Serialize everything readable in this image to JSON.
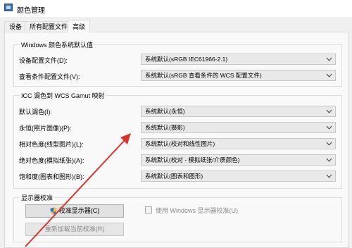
{
  "window": {
    "title": "颜色管理"
  },
  "tabs": [
    {
      "label": "设备"
    },
    {
      "label": "所有配置文件"
    },
    {
      "label": "高级"
    }
  ],
  "windows_defaults": {
    "title": "Windows 颜色系统默认值",
    "rows": [
      {
        "label": "设备配置文件(D):",
        "value": "系统默认(sRGB IEC61966-2.1)"
      },
      {
        "label": "查看条件配置文件(V):",
        "value": "系统默认(sRGB 查看条件的 WCS 配置文件)"
      }
    ]
  },
  "gamut_mapping": {
    "title": "ICC 调色到 WCS Gamut 映射",
    "rows": [
      {
        "label": "默认调色(I):",
        "value": "系统默认(永恒)"
      },
      {
        "label": "永恒(照片图像)(P):",
        "value": "系统默认(摄影)"
      },
      {
        "label": "相对色度(线型图片)(L):",
        "value": "系统默认(校对和线性图片)"
      },
      {
        "label": "绝对色度(模拟纸张)(A):",
        "value": "系统默认(校对 - 模拟纸张/介质颜色)"
      },
      {
        "label": "饱和度(图表和图形)(B):",
        "value": "系统默认(图表和图形)"
      }
    ]
  },
  "display_calibration": {
    "title": "显示器校准",
    "calibrate_button": "校准显示器(C)",
    "reload_button": "重新加载当前校准(R)",
    "use_windows_calibration": "使用 Windows 显示器校准(U)"
  },
  "annotation": {
    "arrow_color": "#d9342b"
  }
}
